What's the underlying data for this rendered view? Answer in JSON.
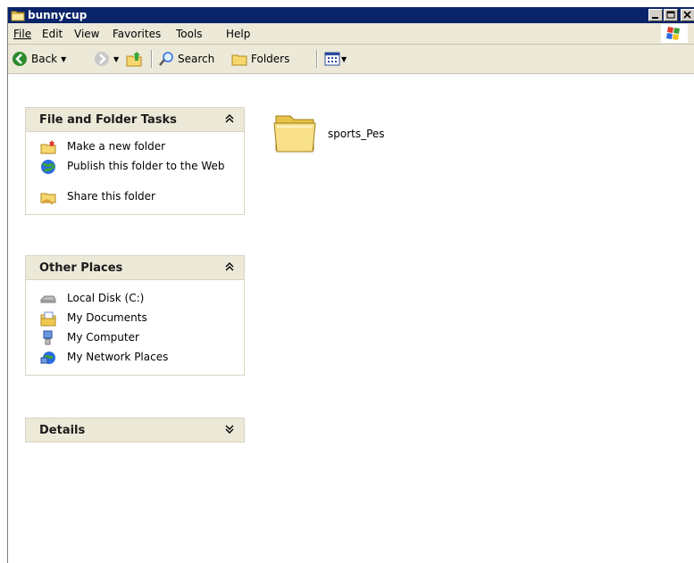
{
  "window": {
    "title": "bunnycup"
  },
  "menu": {
    "items": [
      "File",
      "Edit",
      "View",
      "Favorites",
      "Tools",
      "Help"
    ]
  },
  "toolbar": {
    "back_label": "Back",
    "search_label": "Search",
    "folders_label": "Folders"
  },
  "tasks_panel": {
    "title": "File and Folder Tasks",
    "items": [
      {
        "label": "Make a new folder",
        "icon": "new-folder-icon"
      },
      {
        "label": "Publish this folder to the Web",
        "icon": "publish-web-icon"
      },
      {
        "label": "Share this folder",
        "icon": "share-folder-icon"
      }
    ]
  },
  "places_panel": {
    "title": "Other Places",
    "items": [
      {
        "label": "Local Disk (C:)",
        "icon": "local-disk-icon"
      },
      {
        "label": "My Documents",
        "icon": "my-documents-icon"
      },
      {
        "label": "My Computer",
        "icon": "my-computer-icon"
      },
      {
        "label": "My Network Places",
        "icon": "network-places-icon"
      }
    ]
  },
  "details_panel": {
    "title": "Details"
  },
  "content": {
    "items": [
      {
        "name": "sports_Pes",
        "type": "folder"
      }
    ]
  },
  "colors": {
    "title_bar": "#0a246a",
    "panel_header": "#ece9d8",
    "folder_yellow": "#f5d76e"
  }
}
